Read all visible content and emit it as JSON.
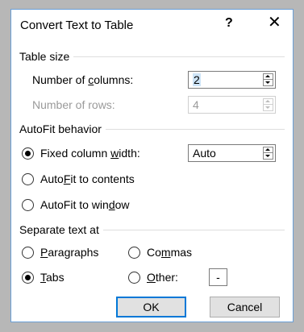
{
  "title": "Convert Text to Table",
  "title_buttons": {
    "help": "?",
    "close": "✕"
  },
  "table_size": {
    "heading": "Table size",
    "columns_label": {
      "pre": "Number of ",
      "u": "c",
      "post": "olumns:"
    },
    "columns_value": "2",
    "rows_label": "Number of rows:",
    "rows_value": "4"
  },
  "autofit": {
    "heading": "AutoFit behavior",
    "fixed": {
      "pre": "Fixed column ",
      "u": "w",
      "post": "idth:",
      "selected": true
    },
    "fixed_value": "Auto",
    "contents": {
      "pre": "Auto",
      "u": "F",
      "post": "it to contents",
      "selected": false
    },
    "window": {
      "pre": "AutoFit to win",
      "u": "d",
      "post": "ow",
      "selected": false
    }
  },
  "separate": {
    "heading": "Separate text at",
    "paragraphs": {
      "pre": "",
      "u": "P",
      "post": "aragraphs",
      "selected": false
    },
    "commas": {
      "pre": "Co",
      "u": "m",
      "post": "mas",
      "selected": false
    },
    "tabs": {
      "pre": "",
      "u": "T",
      "post": "abs",
      "selected": true
    },
    "other": {
      "pre": "",
      "u": "O",
      "post": "ther:",
      "selected": false
    },
    "other_value": "-"
  },
  "buttons": {
    "ok": "OK",
    "cancel": "Cancel"
  },
  "colors": {
    "accent": "#0078d7",
    "disabled_text": "#9a9a9a"
  }
}
